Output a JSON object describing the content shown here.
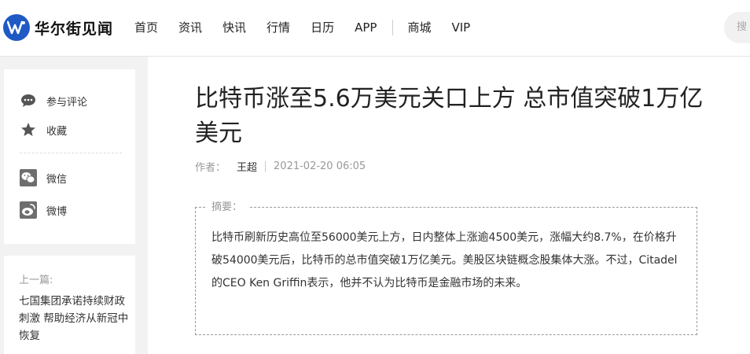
{
  "header": {
    "logo_text": "华尔街见闻",
    "nav": [
      "首页",
      "资讯",
      "快讯",
      "行情",
      "日历",
      "APP"
    ],
    "nav_extra": [
      "商城",
      "VIP"
    ],
    "search_placeholder": "搜"
  },
  "share": {
    "items": [
      {
        "label": "参与评论",
        "icon": "comment-icon"
      },
      {
        "label": "收藏",
        "icon": "star-icon"
      },
      {
        "label": "微信",
        "icon": "wechat-icon"
      },
      {
        "label": "微博",
        "icon": "weibo-icon"
      }
    ]
  },
  "prev": {
    "label": "上一篇:",
    "title": "七国集团承诺持续财政刺激 帮助经济从新冠中恢复"
  },
  "article": {
    "title": "比特币涨至5.6万美元关口上方 总市值突破1万亿美元",
    "author_label": "作者：",
    "author": "王超",
    "date": "2021-02-20 06:05",
    "summary_label": "摘要：",
    "summary": "比特币刷新历史高位至56000美元上方，日内整体上涨逾4500美元，涨幅大约8.7%，在价格升破54000美元后，比特币的总市值突破1万亿美元。美股区块链概念股集体大涨。不过，Citadel的CEO Ken Griffin表示，他并不认为比特币是金融市场的未来。"
  },
  "colors": {
    "brand": "#1f59c4",
    "page_bg": "#f2f2f2"
  }
}
